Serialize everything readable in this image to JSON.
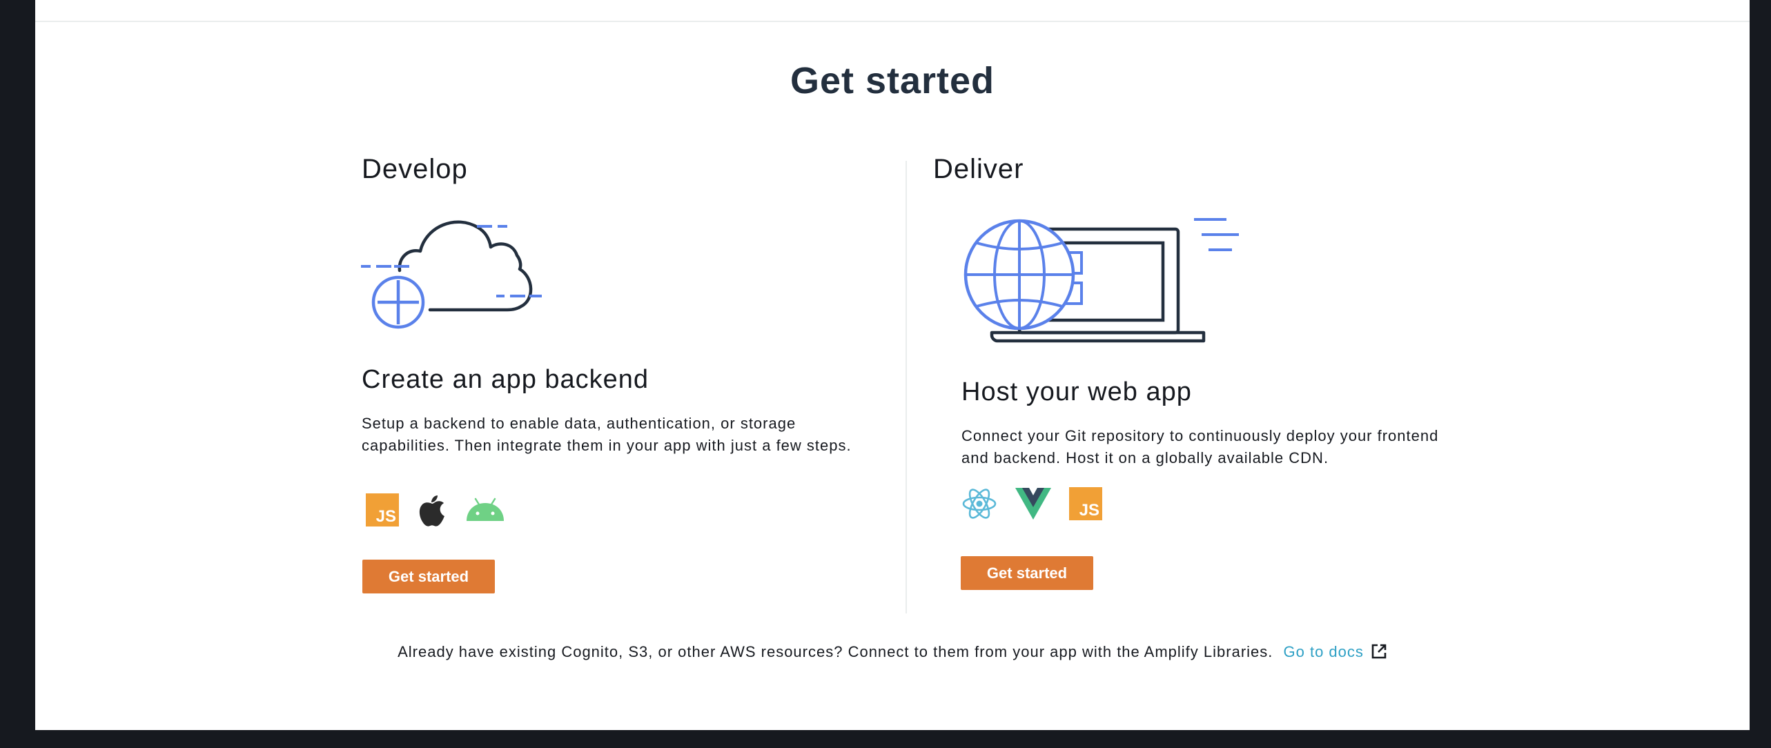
{
  "page": {
    "title": "Get started"
  },
  "develop": {
    "heading": "Develop",
    "card_title": "Create an app backend",
    "description": "Setup a backend to enable data, authentication, or storage capabilities. Then integrate them in your app with just a few steps.",
    "platform_icons": [
      "javascript-icon",
      "apple-icon",
      "android-icon"
    ],
    "js_badge_text": "JS",
    "button_label": "Get started",
    "illustration": "cloud-plus-icon"
  },
  "deliver": {
    "heading": "Deliver",
    "card_title": "Host your web app",
    "description": "Connect your Git repository to continuously deploy your frontend and backend. Host it on a globally available CDN.",
    "platform_icons": [
      "react-icon",
      "vue-icon",
      "javascript-icon"
    ],
    "js_badge_text": "JS",
    "button_label": "Get started",
    "illustration": "globe-laptop-icon"
  },
  "footer": {
    "text": "Already have existing Cognito, S3, or other AWS resources? Connect to them from your app with the Amplify Libraries.",
    "link_label": "Go to docs",
    "link_icon": "external-link-icon"
  },
  "colors": {
    "accent_button": "#df7a34",
    "link": "#2ea0c5",
    "illustration_blue": "#5a81ea",
    "illustration_dark": "#232f3e",
    "js_yellow": "#f1a036",
    "android_green": "#6fd185",
    "vue_green": "#41b883",
    "vue_dark": "#35495e"
  }
}
